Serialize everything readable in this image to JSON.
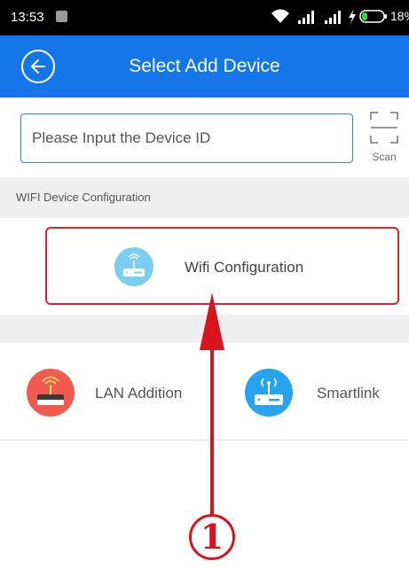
{
  "status_bar": {
    "time": "13:53",
    "battery": "18%"
  },
  "header": {
    "title": "Select Add Device"
  },
  "device_id": {
    "placeholder": "Please Input the Device ID",
    "value": ""
  },
  "scan": {
    "label": "Scan"
  },
  "wifi_section": {
    "header": "WIFI Device Configuration",
    "wifi_config_label": "Wifi Configuration"
  },
  "options": {
    "lan_label": "LAN Addition",
    "smartlink_label": "Smartlink"
  },
  "annotation": {
    "step_number": "1"
  },
  "icons": {
    "back": "back-arrow-circle-icon",
    "scan": "scan-frame-icon",
    "wifi_config": "router-wifi-icon",
    "lan": "lan-router-icon",
    "smartlink": "smartlink-router-icon"
  },
  "colors": {
    "primary": "#1576ea",
    "highlight": "#e0232d",
    "section_bg": "#efefef",
    "wifi_icon": "#7ccdf2",
    "lan_icon": "#f05a4f",
    "smartlink_icon": "#27a3f0"
  }
}
